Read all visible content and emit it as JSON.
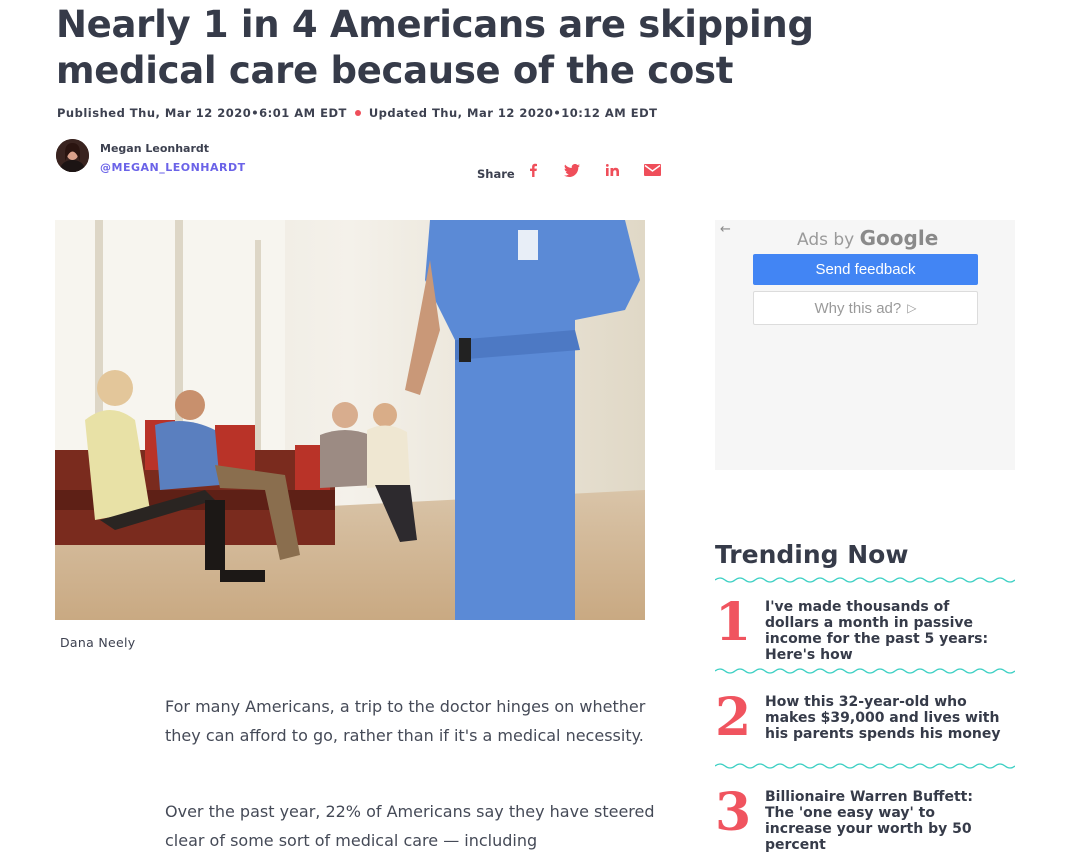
{
  "article": {
    "headline": "Nearly 1 in 4 Americans are skipping medical care because of the cost",
    "published": "Published Thu, Mar 12 2020•6:01 AM EDT",
    "updated": "Updated Thu, Mar 12 2020•10:12 AM EDT",
    "author_name": "Megan Leonhardt",
    "author_handle": "@MEGAN_LEONHARDT",
    "share_label": "Share",
    "share_icons": [
      "facebook-icon",
      "twitter-icon",
      "linkedin-icon",
      "email-icon"
    ],
    "image_caption": "Dana Neely",
    "paragraphs": [
      "For many Americans, a trip to the doctor hinges on whether they can afford to go, rather than if it's a medical necessity.",
      "Over the past year, 22% of Americans say they have steered clear of some sort of medical care — including"
    ]
  },
  "ad": {
    "back_icon": "←",
    "ads_by": "Ads by",
    "google": "Google",
    "send_feedback": "Send feedback",
    "why_this_ad": "Why this ad?",
    "why_icon": "▷"
  },
  "trending": {
    "title": "Trending Now",
    "items": [
      {
        "num": "1",
        "text": "I've made thousands of dollars a month in passive income for the past 5 years: Here's how"
      },
      {
        "num": "2",
        "text": "How this 32-year-old who makes $39,000 and lives with his parents spends his money"
      },
      {
        "num": "3",
        "text": "Billionaire Warren Buffett: The 'one easy way' to increase your worth by 50 percent"
      }
    ]
  },
  "colors": {
    "accent_red": "#ef4e5a",
    "handle_purple": "#6b63e8",
    "wave_teal": "#3ed0c4",
    "google_blue": "#4285f4"
  }
}
